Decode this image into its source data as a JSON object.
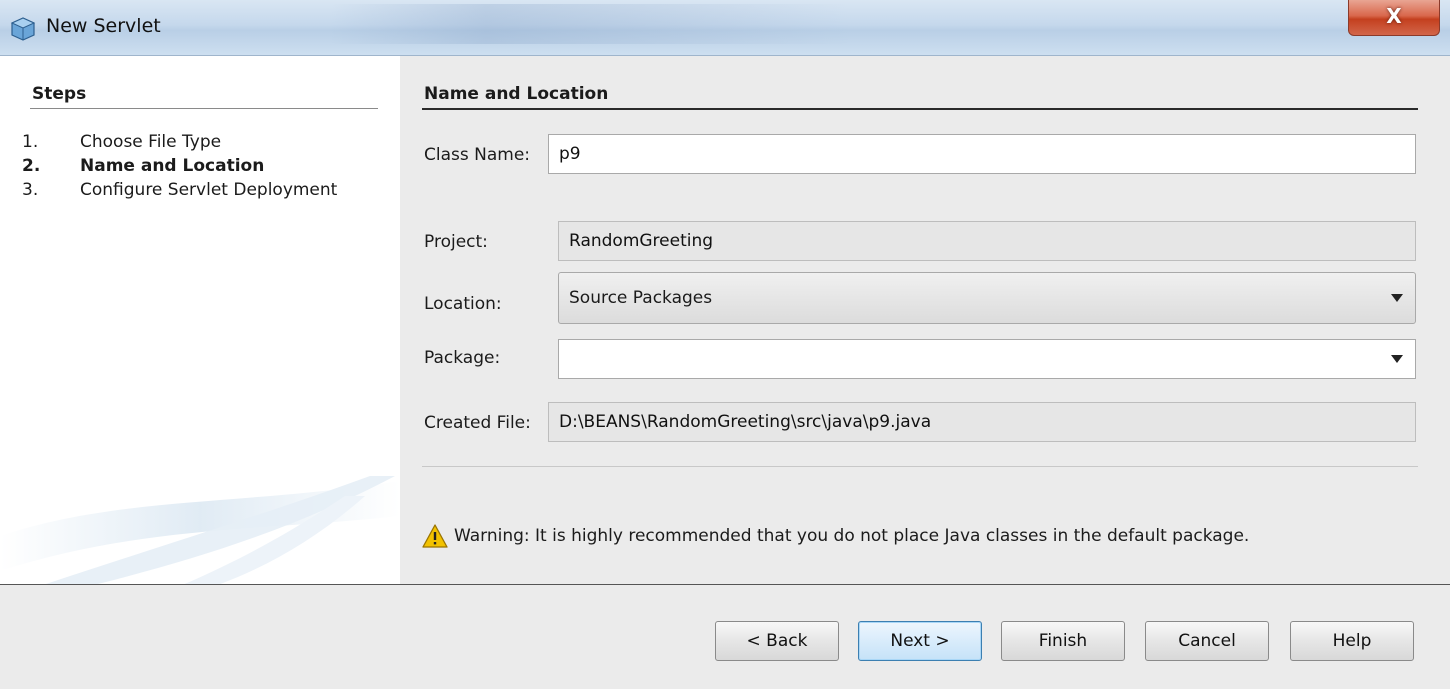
{
  "window": {
    "title": "New Servlet",
    "close_label": "X"
  },
  "steps": {
    "title": "Steps",
    "items": [
      {
        "num": "1.",
        "label": "Choose File Type",
        "current": false
      },
      {
        "num": "2.",
        "label": "Name and Location",
        "current": true
      },
      {
        "num": "3.",
        "label": "Configure Servlet Deployment",
        "current": false
      }
    ]
  },
  "form": {
    "title": "Name and Location",
    "class_name": {
      "label": "Class Name:",
      "value": "p9"
    },
    "project": {
      "label": "Project:",
      "value": "RandomGreeting"
    },
    "location": {
      "label": "Location:",
      "value": "Source Packages"
    },
    "package": {
      "label": "Package:",
      "value": ""
    },
    "created_file": {
      "label": "Created File:",
      "value": "D:\\BEANS\\RandomGreeting\\src\\java\\p9.java"
    },
    "warning": "Warning: It is highly recommended that you do not place Java classes in the default package."
  },
  "buttons": {
    "back": "< Back",
    "next": "Next >",
    "finish": "Finish",
    "cancel": "Cancel",
    "help": "Help"
  },
  "icons": {
    "app": "netbeans-cube-icon",
    "warning": "warning-triangle-icon",
    "dropdown": "chevron-down-icon"
  },
  "colors": {
    "titlebar": "#c5d8ec",
    "close": "#c4401f",
    "panel": "#ebebeb",
    "default_button_border": "#3c7fb1",
    "warning": "#f2c200"
  }
}
